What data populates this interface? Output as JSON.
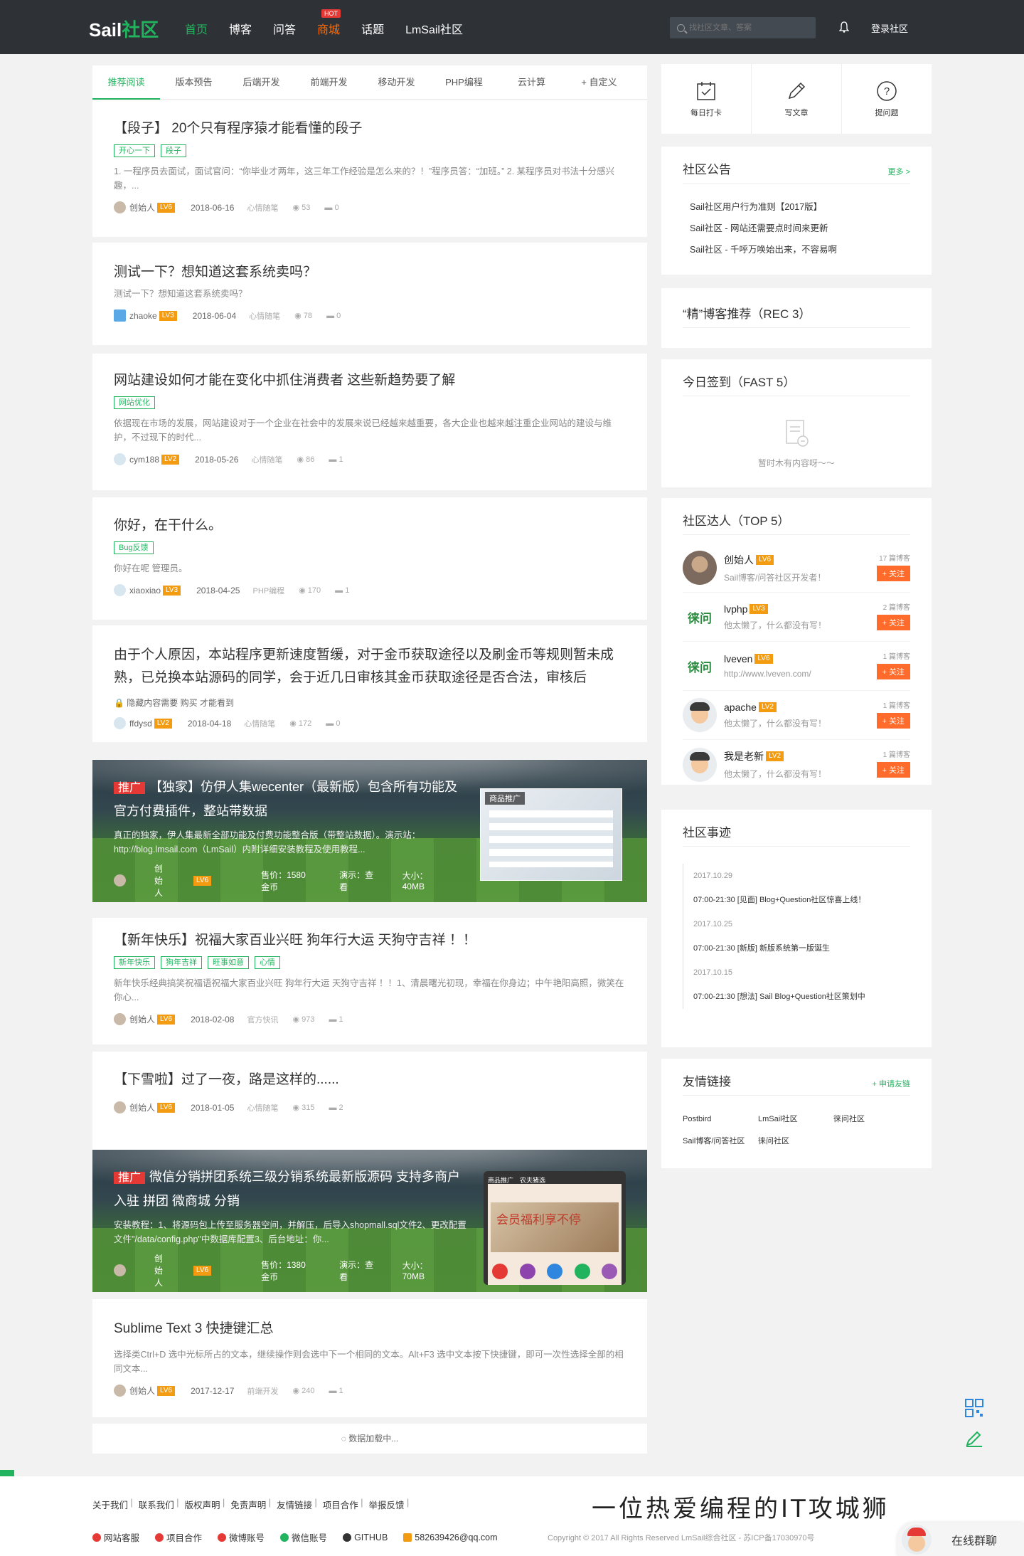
{
  "header": {
    "logo_main": "Sail",
    "logo_accent": "社区",
    "nav": [
      {
        "label": "首页",
        "active": true
      },
      {
        "label": "博客"
      },
      {
        "label": "问答"
      },
      {
        "label": "商城",
        "badge": "HOT"
      },
      {
        "label": "话题"
      },
      {
        "label": "LmSail社区"
      }
    ],
    "search_placeholder": "找社区文章、答案",
    "login_label": "登录社区"
  },
  "tabs": [
    "推荐阅读",
    "版本预告",
    "后端开发",
    "前端开发",
    "移动开发",
    "PHP编程",
    "云计算",
    "+ 自定义"
  ],
  "posts": [
    {
      "title": "【段子】 20个只有程序猿才能看懂的段子",
      "tags": [
        "开心一下",
        "段子"
      ],
      "excerpt": "1. 一程序员去面试，面试官问：“你毕业才两年，这三年工作经验是怎么来的？！”程序员答：“加班。” 2. 某程序员对书法十分感兴趣，...",
      "author": "创始人",
      "level": "LV6",
      "date": "2018-06-16",
      "category": "心情随笔",
      "views": "53",
      "comments": "0"
    },
    {
      "title": "测试一下？想知道这套系统卖吗？",
      "excerpt": "测试一下？想知道这套系统卖吗？",
      "author": "zhaoke",
      "level": "LV3",
      "date": "2018-06-04",
      "category": "心情随笔",
      "views": "78",
      "comments": "0"
    },
    {
      "title": "网站建设如何才能在变化中抓住消费者 这些新趋势要了解",
      "tags": [
        "网站优化"
      ],
      "excerpt": "依据现在市场的发展，网站建设对于一个企业在社会中的发展来说已经越来越重要，各大企业也越来越注重企业网站的建设与维护，不过现下的时代...",
      "author": "cym188",
      "level": "LV2",
      "date": "2018-05-26",
      "category": "心情随笔",
      "views": "86",
      "comments": "1"
    },
    {
      "title": "你好，在干什么。",
      "tags": [
        "Bug反馈"
      ],
      "excerpt": "你好在呢 管理员。",
      "author": "xiaoxiao",
      "level": "LV3",
      "date": "2018-04-25",
      "category": "PHP编程",
      "views": "170",
      "comments": "1"
    },
    {
      "title": "由于个人原因，本站程序更新速度暂缓，对于金币获取途径以及刷金币等规则暂未成熟，已兑换本站源码的同学，会于近几日审核其金币获取途径是否合法，审核后",
      "hidden_note": "隐藏内容需要 购买 才能看到",
      "author": "ffdysd",
      "level": "LV2",
      "date": "2018-04-18",
      "category": "心情随笔",
      "views": "172",
      "comments": "0"
    },
    {
      "title": "【新年快乐】祝福大家百业兴旺 狗年行大运 天狗守吉祥 ！！",
      "tags": [
        "新年快乐",
        "狗年吉祥",
        "旺事如意",
        "心情"
      ],
      "excerpt": "新年快乐经典搞笑祝福语祝福大家百业兴旺 狗年行大运 天狗守吉祥 ！！1、清晨曙光初现，幸福在你身边；中午艳阳高照，微笑在你心...",
      "author": "创始人",
      "level": "LV6",
      "date": "2018-02-08",
      "category": "官方快讯",
      "views": "973",
      "comments": "1"
    },
    {
      "title": "【下雪啦】过了一夜，路是这样的......",
      "author": "创始人",
      "level": "LV6",
      "date": "2018-01-05",
      "category": "心情随笔",
      "views": "315",
      "comments": "2"
    },
    {
      "title": "Sublime Text 3 快捷键汇总",
      "excerpt": "选择类Ctrl+D 选中光标所占的文本，继续操作则会选中下一个相同的文本。Alt+F3 选中文本按下快捷键，即可一次性选择全部的相同文本...",
      "author": "创始人",
      "level": "LV6",
      "date": "2017-12-17",
      "category": "前端开发",
      "views": "240",
      "comments": "1"
    }
  ],
  "promos": [
    {
      "badge": "推广",
      "title": "【独家】仿伊人集wecenter（最新版）包含所有功能及官方付费插件，整站带数据",
      "desc": "真正的独家，伊人集最新全部功能及付费功能整合版（带整站数据）。演示站：http://blog.lmsail.com（LmSail）内附详细安装教程及使用教程...",
      "author": "创始人",
      "level": "LV6",
      "price": "售价：1580金币",
      "demo": "演示：查看",
      "size": "大小：40MB",
      "shot_label": "商品推广"
    },
    {
      "badge": "推广",
      "title": "微信分销拼团系统三级分销系统最新版源码 支持多商户入驻 拼团 微商城 分销",
      "desc": "安装教程：1、将源码包上传至服务器空间，并解压，后导入shopmall.sql文件2、更改配置文件\"/data/config.php\"中数据库配置3、后台地址：你...",
      "author": "创始人",
      "level": "LV6",
      "price": "售价：1380金币",
      "demo": "演示：查看",
      "size": "大小：70MB",
      "shot_label": "商品推广",
      "phone_header": "农夫猪选",
      "phone_hero": "会员福利享不停"
    }
  ],
  "loading_text": "数据加载中...",
  "sidebar": {
    "quick": [
      {
        "label": "每日打卡",
        "icon": "calendar-check-icon"
      },
      {
        "label": "写文章",
        "icon": "pencil-icon"
      },
      {
        "label": "提问题",
        "icon": "question-icon"
      }
    ],
    "notice": {
      "title": "社区公告",
      "more": "更多 >",
      "items": [
        "Sail社区用户行为准则【2017版】",
        "Sail社区 - 网站还需要点时间来更新",
        "Sail社区 - 千呼万唤始出来，不容易啊"
      ]
    },
    "recommend": {
      "title": "“精”博客推荐（REC 3）"
    },
    "checkin": {
      "title": "今日签到（FAST 5）",
      "empty": "暂时木有内容呀～～"
    },
    "talents": {
      "title": "社区达人（TOP 5）",
      "items": [
        {
          "name": "创始人",
          "level": "LV6",
          "sub": "Sail博客/问答社区开发者！",
          "count": "17 篇博客",
          "follow": "+ 关注"
        },
        {
          "name": "lvphp",
          "level": "LV3",
          "sub": "他太懒了，什么都没有写！",
          "count": "2 篇博客",
          "follow": "+ 关注"
        },
        {
          "name": "lveven",
          "level": "LV6",
          "sub": "http://www.lveven.com/",
          "count": "1 篇博客",
          "follow": "+ 关注"
        },
        {
          "name": "apache",
          "level": "LV2",
          "sub": "他太懒了，什么都没有写！",
          "count": "1 篇博客",
          "follow": "+ 关注"
        },
        {
          "name": "我是老新",
          "level": "LV2",
          "sub": "他太懒了，什么都没有写！",
          "count": "1 篇博客",
          "follow": "+ 关注"
        }
      ],
      "logo_text": "徕问"
    },
    "events": {
      "title": "社区事迹",
      "items": [
        {
          "date": "2017.10.29",
          "event": "07:00-21:30 [见面] Blog+Question社区惊喜上线！"
        },
        {
          "date": "2017.10.25",
          "event": "07:00-21:30 [新版] 新版系统第一版诞生"
        },
        {
          "date": "2017.10.15",
          "event": "07:00-21:30 [想法] Sail Blog+Question社区策划中"
        }
      ]
    },
    "links": {
      "title": "友情链接",
      "apply": "+ 申请友链",
      "items": [
        "Postbird",
        "LmSail社区",
        "徕问社区",
        "Sail博客/问答社区",
        "徕问社区"
      ]
    }
  },
  "footer": {
    "links": [
      "关于我们",
      "联系我们",
      "版权声明",
      "免责声明",
      "友情链接",
      "项目合作",
      "举报反馈"
    ],
    "slogan": "一位热爱编程的IT攻城狮",
    "icons": [
      {
        "label": "网站客服",
        "color": "#e53935"
      },
      {
        "label": "项目合作",
        "color": "#e53935"
      },
      {
        "label": "微博账号",
        "color": "#e53935"
      },
      {
        "label": "微信账号",
        "color": "#22b35e"
      },
      {
        "label": "GITHUB",
        "color": "#333333"
      },
      {
        "label": "582639426@qq.com",
        "color": "#f39c12"
      }
    ],
    "copyright": "Copyright © 2017 All Rights Reserved LmSail综合社区 - 苏ICP备17030970号",
    "chat_label": "在线群聊"
  }
}
